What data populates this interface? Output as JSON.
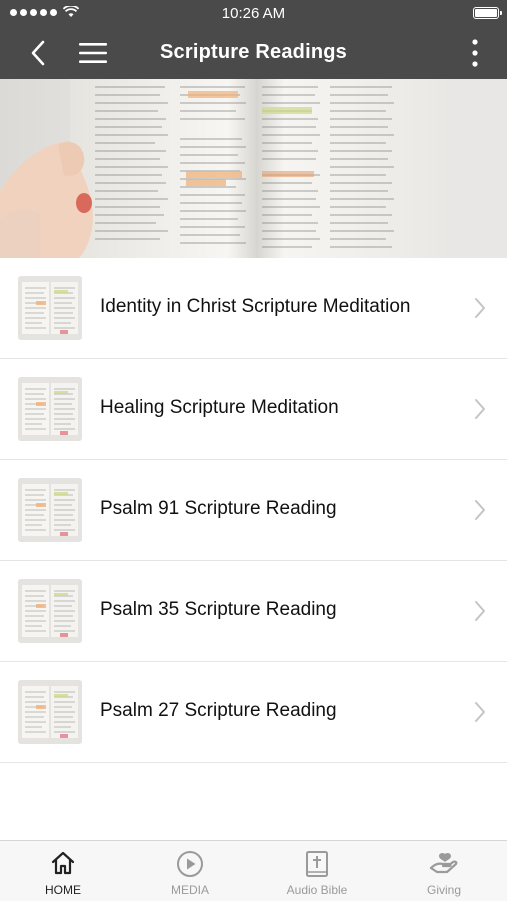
{
  "status_bar": {
    "time": "10:26 AM"
  },
  "header": {
    "title": "Scripture Readings"
  },
  "items": [
    {
      "label": "Identity in Christ Scripture Meditation"
    },
    {
      "label": "Healing Scripture Meditation"
    },
    {
      "label": "Psalm 91 Scripture Reading"
    },
    {
      "label": "Psalm 35 Scripture Reading"
    },
    {
      "label": "Psalm 27 Scripture Reading"
    }
  ],
  "tabs": [
    {
      "label": "HOME",
      "icon": "home-icon",
      "active": true
    },
    {
      "label": "MEDIA",
      "icon": "play-circle-icon",
      "active": false
    },
    {
      "label": "Audio Bible",
      "icon": "bible-icon",
      "active": false
    },
    {
      "label": "Giving",
      "icon": "giving-hand-icon",
      "active": false
    }
  ],
  "colors": {
    "bar": "#4a4a4a",
    "active_tab": "#222222",
    "inactive_tab": "#9a9a9a",
    "highlight": "#f0b27a"
  }
}
